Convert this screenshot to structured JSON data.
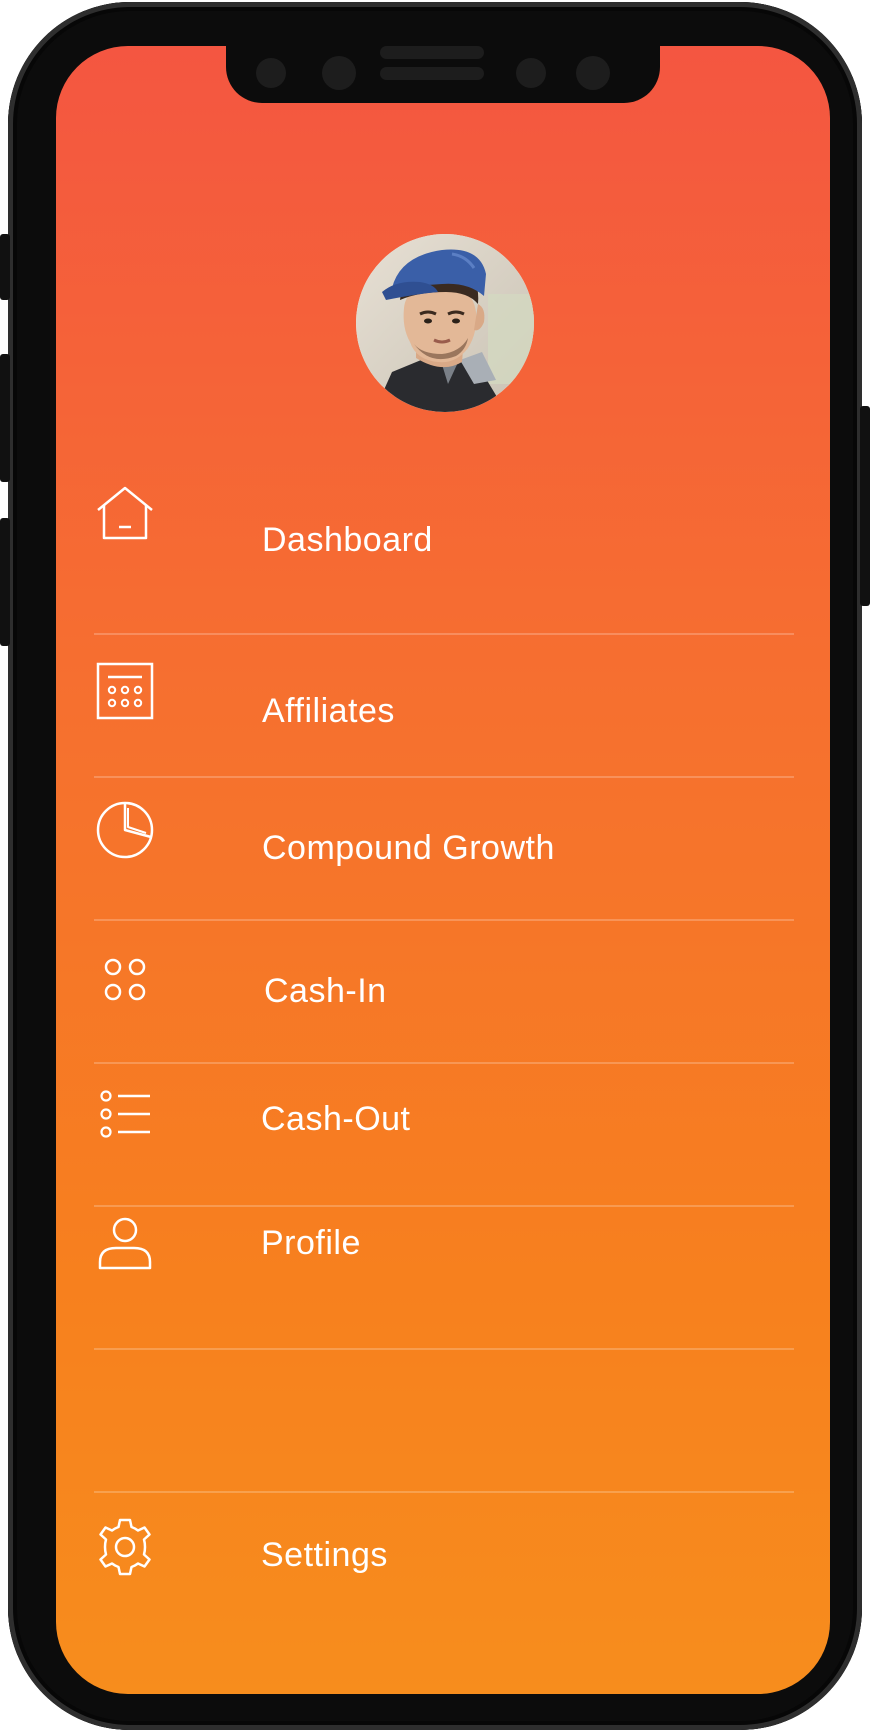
{
  "app": {
    "accent_top": "#f45641",
    "accent_bottom": "#f78d1d"
  },
  "profile": {
    "avatar": "user-avatar-photo"
  },
  "menu": {
    "items": [
      {
        "label": "Dashboard",
        "icon": "home-icon"
      },
      {
        "label": "Affiliates",
        "icon": "calendar-grid-icon"
      },
      {
        "label": "Compound Growth",
        "icon": "pie-chart-icon"
      },
      {
        "label": "Cash-In",
        "icon": "four-dots-icon"
      },
      {
        "label": "Cash-Out",
        "icon": "list-icon"
      },
      {
        "label": "Profile",
        "icon": "user-icon"
      },
      {
        "label": "",
        "icon": ""
      },
      {
        "label": "Settings",
        "icon": "gear-icon"
      }
    ]
  }
}
